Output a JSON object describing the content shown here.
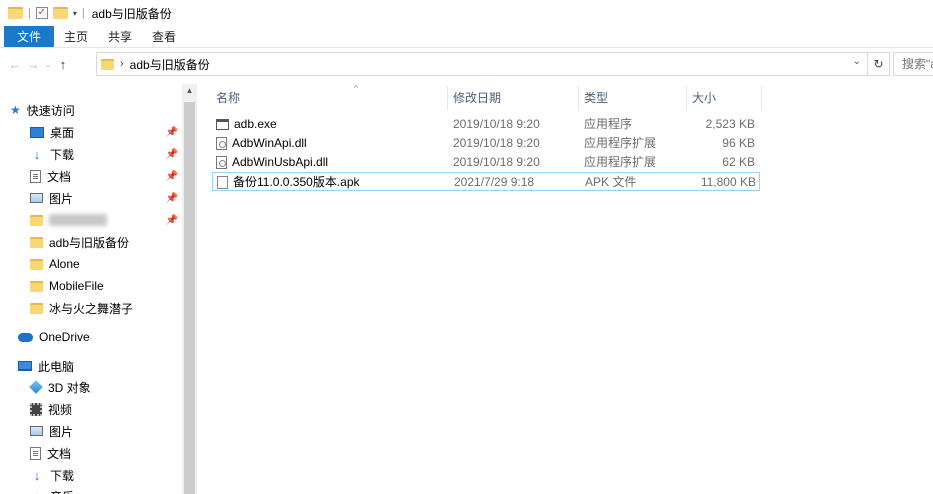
{
  "window": {
    "title": "adb与旧版备份"
  },
  "ribbon": {
    "tabs": [
      "文件",
      "主页",
      "共享",
      "查看"
    ]
  },
  "address": {
    "path": "adb与旧版备份",
    "search_placeholder": "搜索\"adb与旧版备份\""
  },
  "nav": {
    "quick_access": "快速访问",
    "desktop": "桌面",
    "downloads": "下载",
    "documents": "文档",
    "pictures": "图片",
    "folders": [
      "adb与旧版备份",
      "Alone",
      "MobileFile",
      "冰与火之舞潜子"
    ],
    "onedrive": "OneDrive",
    "this_pc": "此电脑",
    "objects3d": "3D 对象",
    "videos": "视频",
    "pc_pictures": "图片",
    "pc_documents": "文档",
    "pc_downloads": "下载",
    "music": "音乐"
  },
  "columns": {
    "name": "名称",
    "date": "修改日期",
    "type": "类型",
    "size": "大小"
  },
  "files": [
    {
      "name": "adb.exe",
      "date": "2019/10/18 9:20",
      "type": "应用程序",
      "size": "2,523 KB",
      "icon": "exe-icon"
    },
    {
      "name": "AdbWinApi.dll",
      "date": "2019/10/18 9:20",
      "type": "应用程序扩展",
      "size": "96 KB",
      "icon": "dll-icon"
    },
    {
      "name": "AdbWinUsbApi.dll",
      "date": "2019/10/18 9:20",
      "type": "应用程序扩展",
      "size": "62 KB",
      "icon": "dll-icon"
    },
    {
      "name": "备份11.0.0.350版本.apk",
      "date": "2021/7/29 9:18",
      "type": "APK 文件",
      "size": "11,800 KB",
      "icon": "apk-icon"
    }
  ],
  "colors": {
    "file_tab": "#1979ca",
    "selection": "#99d1ff"
  }
}
